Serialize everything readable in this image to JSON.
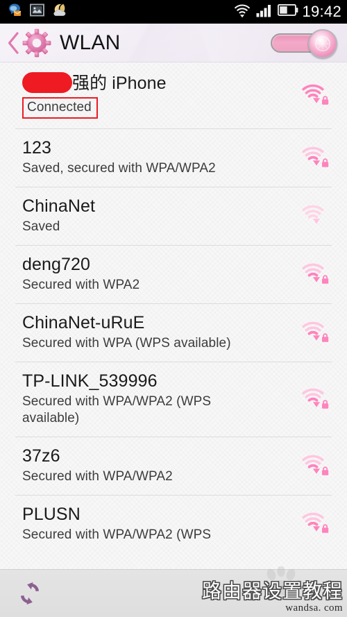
{
  "statusbar": {
    "time": "19:42",
    "left_icons": [
      {
        "name": "mail-icon",
        "label": "Mail"
      },
      {
        "name": "picture-icon",
        "label": "Screenshot"
      },
      {
        "name": "weather-moon-icon",
        "label": "Weather"
      }
    ],
    "right_icons": [
      {
        "name": "wifi-status-icon",
        "label": "Wi-Fi connected"
      },
      {
        "name": "cellular-signal-icon",
        "label": "Signal"
      },
      {
        "name": "battery-icon",
        "label": "Battery"
      }
    ]
  },
  "header": {
    "back_label": "Back",
    "gear_label": "Settings",
    "title": "WLAN",
    "toggle": {
      "name": "wlan-toggle",
      "state": "on",
      "label": "WLAN on"
    }
  },
  "networks": [
    {
      "ssid_redacted": true,
      "ssid": "强的 iPhone",
      "status": "Connected",
      "status_highlighted": true,
      "signal": 4,
      "secured": true
    },
    {
      "ssid_redacted": false,
      "ssid": "123",
      "status": "Saved, secured with WPA/WPA2",
      "status_highlighted": false,
      "signal": 3,
      "secured": true
    },
    {
      "ssid_redacted": false,
      "ssid": "ChinaNet",
      "status": "Saved",
      "status_highlighted": false,
      "signal": 2,
      "secured": false
    },
    {
      "ssid_redacted": false,
      "ssid": "deng720",
      "status": "Secured with WPA2",
      "status_highlighted": false,
      "signal": 3,
      "secured": true
    },
    {
      "ssid_redacted": false,
      "ssid": "ChinaNet-uRuE",
      "status": "Secured with WPA (WPS available)",
      "status_highlighted": false,
      "signal": 3,
      "secured": true
    },
    {
      "ssid_redacted": false,
      "ssid": "TP-LINK_539996",
      "status": "Secured with WPA/WPA2 (WPS available)",
      "status_highlighted": false,
      "signal": 3,
      "secured": true
    },
    {
      "ssid_redacted": false,
      "ssid": "37z6",
      "status": "Secured with WPA/WPA2",
      "status_highlighted": false,
      "signal": 3,
      "secured": true
    },
    {
      "ssid_redacted": false,
      "ssid": "PLUSN",
      "status": "Secured with WPA/WPA2 (WPS",
      "status_highlighted": false,
      "signal": 3,
      "secured": true
    }
  ],
  "bottombar": {
    "scan_label": "Scan",
    "watermark_main": "路由器设置教程",
    "watermark_sub": "wandsa. com"
  },
  "colors": {
    "accent_pink": "#f48fc0",
    "accent_pink_strong": "#ff7ab8",
    "annotation_red": "#ee1b23",
    "header_bg": "#f1ecf5",
    "list_bg": "#f7f7f7",
    "bottom_bg": "#e1e1e1",
    "scan_purple": "#8d5f91"
  }
}
